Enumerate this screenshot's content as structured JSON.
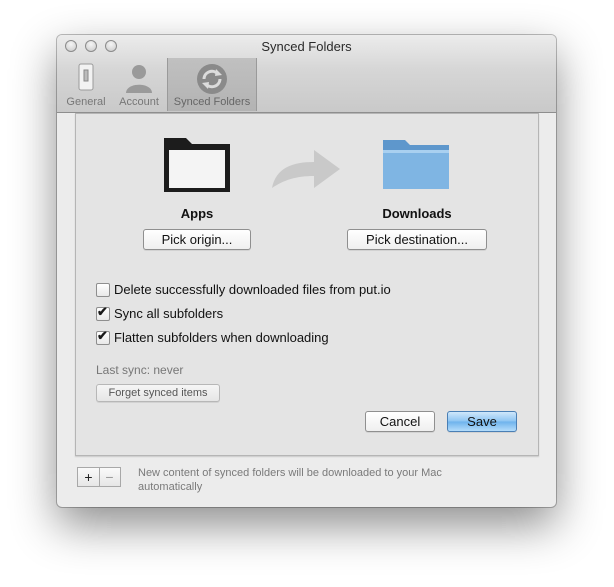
{
  "window": {
    "title": "Synced Folders"
  },
  "toolbar": {
    "items": [
      {
        "label": "General",
        "icon": "switch-icon",
        "selected": false
      },
      {
        "label": "Account",
        "icon": "user-silhouette-icon",
        "selected": false
      },
      {
        "label": "Synced Folders",
        "icon": "sync-arrows-icon",
        "selected": true
      }
    ]
  },
  "origin": {
    "name": "Apps",
    "button": "Pick origin...",
    "icon": "black-folder-icon"
  },
  "arrow_icon": "right-arrow-icon",
  "destination": {
    "name": "Downloads",
    "button": "Pick destination...",
    "icon": "blue-folder-icon",
    "color": "#6fa9dc"
  },
  "options": [
    {
      "label": "Delete successfully downloaded files from put.io",
      "checked": false
    },
    {
      "label": "Sync all subfolders",
      "checked": true
    },
    {
      "label": "Flatten subfolders when downloading",
      "checked": true
    }
  ],
  "last_sync": "Last sync: never",
  "forget_button": "Forget synced items",
  "actions": {
    "cancel": "Cancel",
    "save": "Save"
  },
  "footer": {
    "add": "+",
    "remove": "−",
    "note": "New content of synced folders will be downloaded to your Mac automatically"
  }
}
